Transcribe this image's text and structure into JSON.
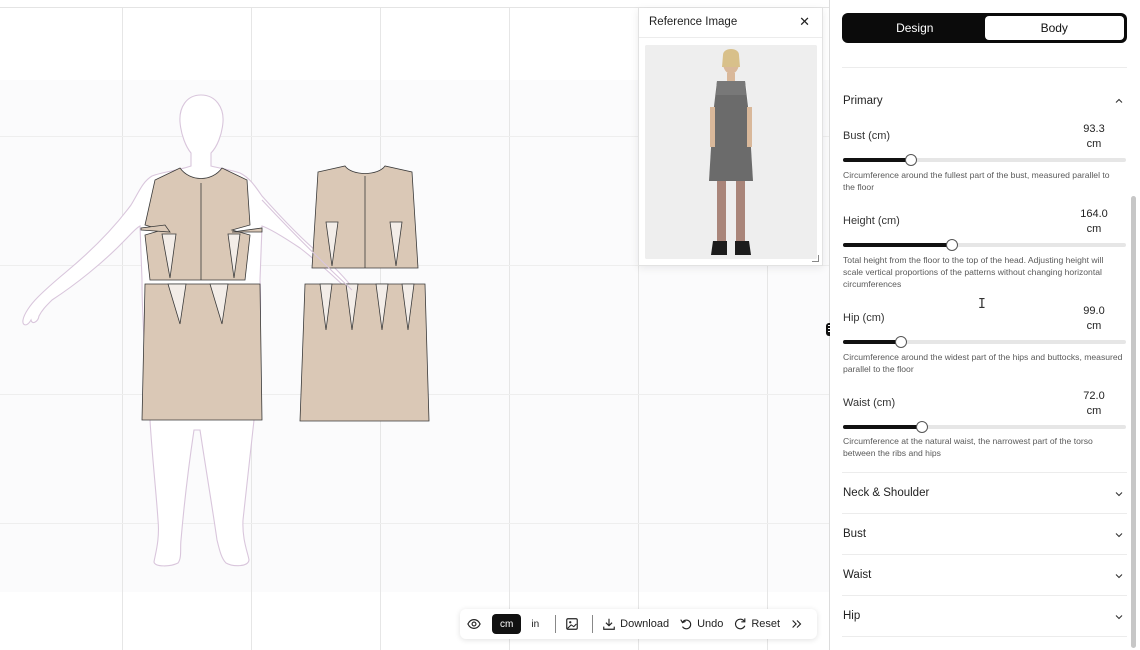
{
  "reference_panel": {
    "title": "Reference Image",
    "close_icon": "close-icon"
  },
  "toolbar": {
    "visibility_icon": "eye-icon",
    "unit_cm": "cm",
    "unit_in": "in",
    "image_icon": "image-icon",
    "download_label": "Download",
    "undo_label": "Undo",
    "reset_label": "Reset",
    "more_icon": "double-chevron-right-icon"
  },
  "tabs": {
    "design": "Design",
    "body": "Body",
    "active": "Body"
  },
  "primary": {
    "title": "Primary",
    "fields": [
      {
        "label": "Bust (cm)",
        "value": "93.3",
        "unit": "cm",
        "fraction": 0.24,
        "description": "Circumference around the fullest part of the bust, measured parallel to the floor"
      },
      {
        "label": "Height (cm)",
        "value": "164.0",
        "unit": "cm",
        "fraction": 0.385,
        "description": "Total height from the floor to the top of the head. Adjusting height will scale vertical proportions of the patterns without changing horizontal circumferences"
      },
      {
        "label": "Hip (cm)",
        "value": "99.0",
        "unit": "cm",
        "fraction": 0.205,
        "description": "Circumference around the widest part of the hips and buttocks, measured parallel to the floor"
      },
      {
        "label": "Waist (cm)",
        "value": "72.0",
        "unit": "cm",
        "fraction": 0.28,
        "description": "Circumference at the natural waist, the narrowest part of the torso between the ribs and hips"
      }
    ]
  },
  "sections": [
    "Neck & Shoulder",
    "Bust",
    "Waist",
    "Hip"
  ],
  "colors": {
    "pattern_fill": "#dac8b6",
    "body_outline": "#d9c6dc",
    "accent": "#111111"
  }
}
